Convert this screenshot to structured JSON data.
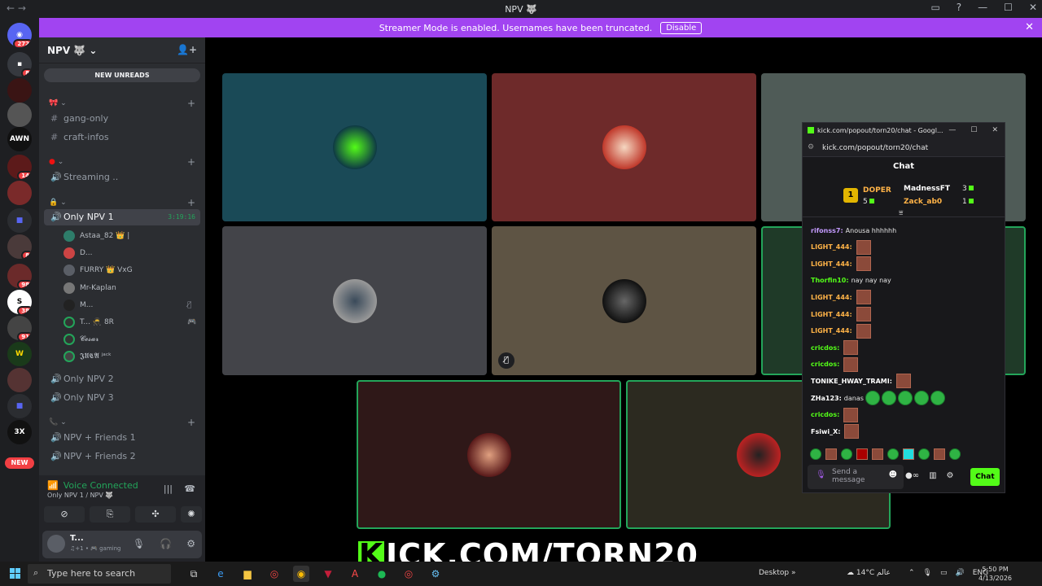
{
  "window": {
    "title": "NPV 🐺",
    "controls": [
      "—",
      "☐",
      "✕"
    ]
  },
  "banner": {
    "text": "Streamer Mode is enabled. Usernames have been truncated.",
    "disable_label": "Disable",
    "close": "✕"
  },
  "rail": {
    "top_badge": "272",
    "badges": [
      "8",
      "14",
      "8",
      "98",
      "38",
      "91"
    ],
    "labels": {
      "awn": "AWN",
      "aircraft": "3X"
    },
    "new_label": "NEW"
  },
  "sidebar": {
    "server_name": "NPV 🐺",
    "new_unreads": "NEW UNREADS",
    "channels": {
      "gang_only": "gang-only",
      "craft_infos": "craft-infos",
      "streaming": "Streaming ..",
      "only_npv1": "Only NPV 1",
      "only_npv1_time": "3:19:16",
      "only_npv2": "Only NPV 2",
      "only_npv3": "Only NPV 3",
      "friends1": "NPV + Friends 1",
      "friends2": "NPV + Friends 2"
    },
    "members": [
      "Astaa_82 👑 |",
      "D...",
      "FURRY 👑 VxG",
      "Mr-Kaplan",
      "M...",
      "T... 🥷 8R",
      "𝓒𝓮𝓼𝓪𝓻",
      "𝕵𝖀𝕮𝕬 ʲᵃᶜᵏ"
    ]
  },
  "voice": {
    "connected_label": "Voice Connected",
    "channel_label": "Only NPV 1 / NPV 🐺",
    "user_name": "T...",
    "user_status": "♫+1 • 🎮 gaming"
  },
  "kick": {
    "window_title": "kick.com/popout/torn20/chat - Googl...",
    "url": "kick.com/popout/torn20/chat",
    "header": "Chat",
    "pinned": {
      "rank": "1",
      "leader": "DOPER",
      "leader_count": "5",
      "second": "MadnessFT",
      "second_count": "3",
      "third": "Zack_ab0",
      "third_count": "1"
    },
    "messages": [
      {
        "user": "rifonss7:",
        "text": "Anousa hhhhhh",
        "color": "#c49bff"
      },
      {
        "user": "LIGHT_444:",
        "text": "",
        "color": "#ffb347"
      },
      {
        "user": "LIGHT_444:",
        "text": "",
        "color": "#ffb347"
      },
      {
        "user": "Thorfin10:",
        "text": "nay nay nay",
        "color": "#53fc18"
      },
      {
        "user": "LIGHT_444:",
        "text": "",
        "color": "#ffb347"
      },
      {
        "user": "LIGHT_444:",
        "text": "",
        "color": "#ffb347"
      },
      {
        "user": "LIGHT_444:",
        "text": "",
        "color": "#ffb347"
      },
      {
        "user": "cricdos:",
        "text": "",
        "color": "#53fc18"
      },
      {
        "user": "cricdos:",
        "text": "",
        "color": "#53fc18"
      },
      {
        "user": "TONIKE_HWAY_TRAMI:",
        "text": "",
        "color": "#ffffff"
      },
      {
        "user": "ZHa123:",
        "text": "danas",
        "color": "#ffffff"
      },
      {
        "user": "cricdos:",
        "text": "",
        "color": "#53fc18"
      },
      {
        "user": "Fsiwi_X:",
        "text": "",
        "color": "#ffffff"
      }
    ],
    "send_placeholder": "Send a message",
    "chat_button": "Chat"
  },
  "overlay": {
    "kick_letter": "K",
    "kick_rest": "ICK.COM/TORN20"
  },
  "taskbar": {
    "search_placeholder": "Type here to search",
    "desktop_label": "Desktop",
    "weather": "14°C عالم",
    "lang": "ENG",
    "time": "5:50 PM",
    "date": "4/13/2026"
  },
  "colors": {
    "accent": "#5865f2",
    "green": "#23a55a",
    "kick": "#53fc18",
    "banner": "#a144f1"
  }
}
